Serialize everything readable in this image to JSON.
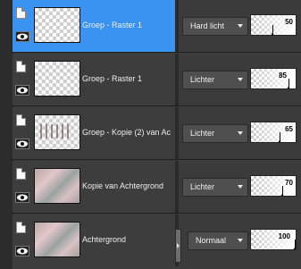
{
  "layers": [
    {
      "name": "Groep - Raster 1",
      "blend_mode": "Hard licht",
      "opacity": 50,
      "thumb": "checker",
      "selected": true
    },
    {
      "name": "Groep - Raster 1",
      "blend_mode": "Lichter",
      "opacity": 85,
      "thumb": "checker",
      "selected": false
    },
    {
      "name": "Groep - Kopie (2) van Ac",
      "blend_mode": "Lichter",
      "opacity": 65,
      "thumb": "kopie",
      "selected": false
    },
    {
      "name": "Kopie van Achtergrond",
      "blend_mode": "Lichter",
      "opacity": 70,
      "thumb": "photo",
      "selected": false
    },
    {
      "name": "Achtergrond",
      "blend_mode": "Normaal",
      "opacity": 100,
      "thumb": "photo",
      "selected": false
    }
  ],
  "colors": {
    "selection": "#3b93f1",
    "panel": "#3d3d3d",
    "dropdown": "#4f4f4f"
  }
}
